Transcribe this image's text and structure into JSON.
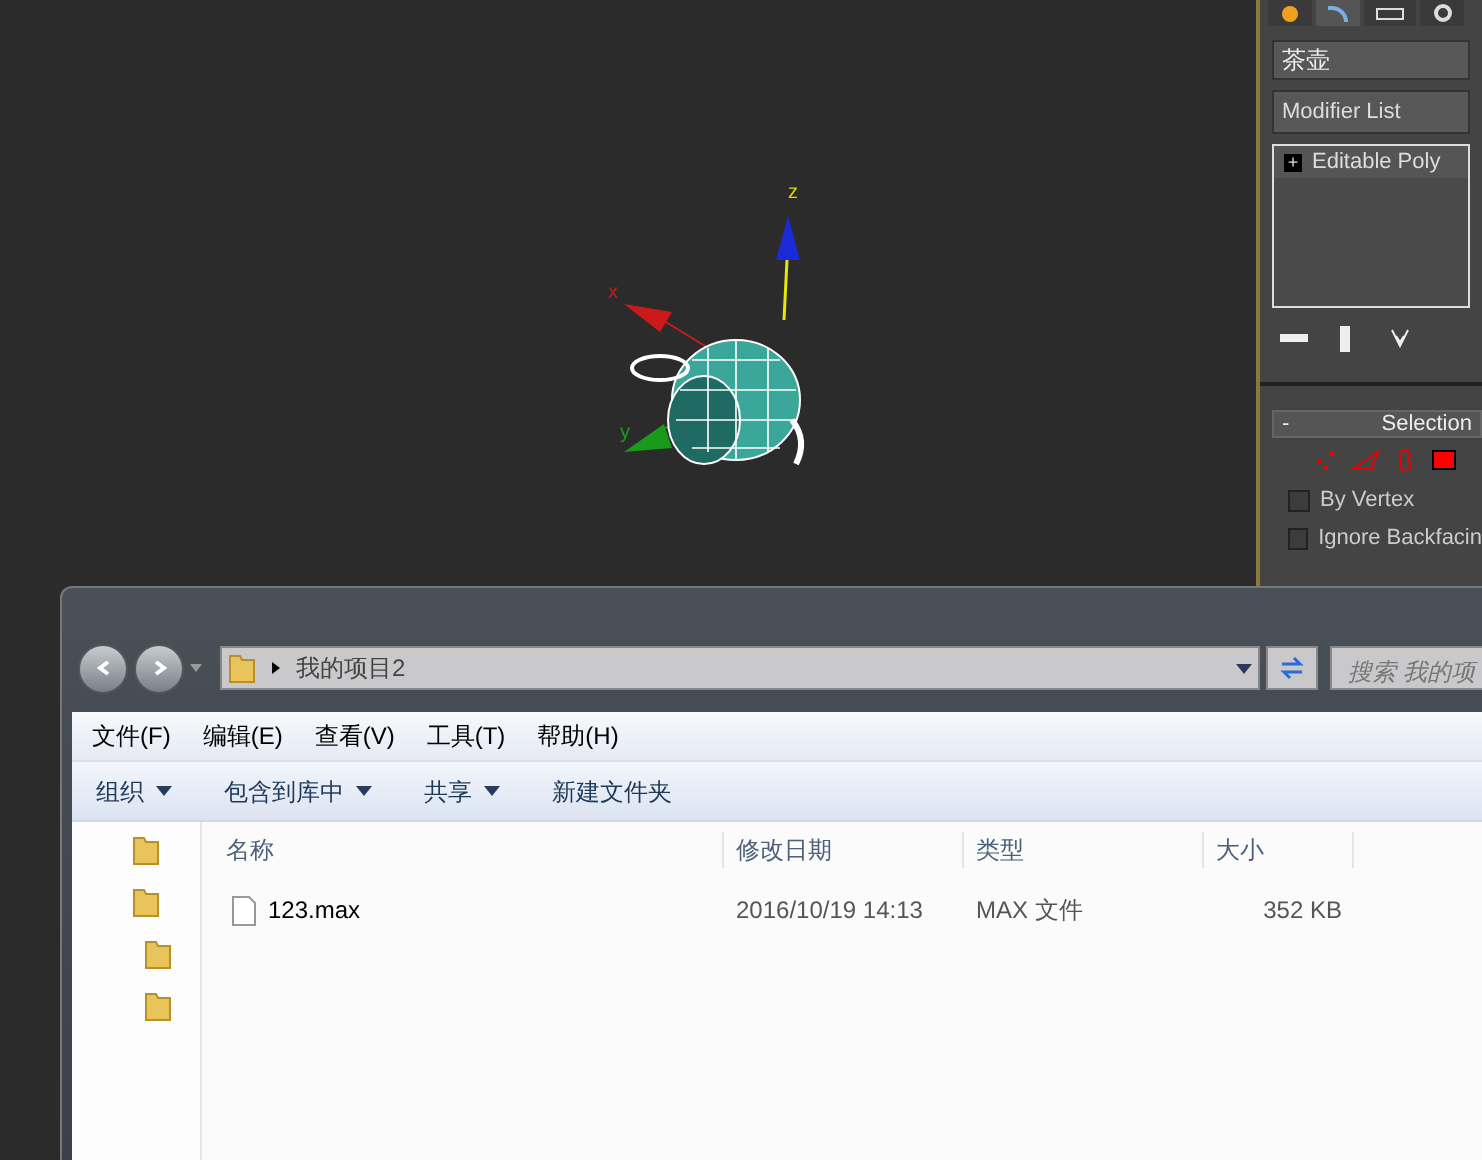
{
  "viewport": {
    "axes": [
      {
        "kind": "x",
        "label": "x"
      },
      {
        "kind": "y",
        "label": "y"
      },
      {
        "kind": "z",
        "label": "z"
      }
    ]
  },
  "command_panel": {
    "object_name": "茶壶",
    "modifier_list": "Modifier List",
    "stack": [
      {
        "label": "Editable Poly",
        "expander": "+"
      }
    ],
    "rollout": {
      "toggle": "-",
      "title": "Selection",
      "options": [
        {
          "label": "By Vertex",
          "checked": false
        },
        {
          "label": "Ignore Backfacin",
          "checked": false
        }
      ]
    }
  },
  "explorer": {
    "address": "我的项目2",
    "search_placeholder": "搜索 我的项",
    "menu": [
      "文件(F)",
      "编辑(E)",
      "查看(V)",
      "工具(T)",
      "帮助(H)"
    ],
    "toolbar": [
      {
        "label": "组织",
        "dropdown": true
      },
      {
        "label": "包含到库中",
        "dropdown": true
      },
      {
        "label": "共享",
        "dropdown": true
      },
      {
        "label": "新建文件夹",
        "dropdown": false
      }
    ],
    "columns": [
      "名称",
      "修改日期",
      "类型",
      "大小"
    ],
    "rows": [
      {
        "name": "123.max",
        "modified": "2016/10/19 14:13",
        "type": "MAX 文件",
        "size": "352 KB"
      }
    ]
  }
}
